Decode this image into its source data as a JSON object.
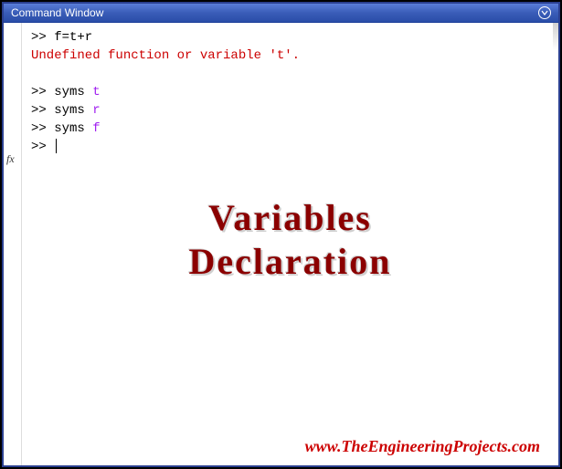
{
  "titlebar": {
    "title": "Command Window"
  },
  "gutter": {
    "fx_label": "fx"
  },
  "console": {
    "line1": ">> f=t+r",
    "error": "Undefined function or variable 't'.",
    "line2_prefix": ">> ",
    "line2_cmd": "syms ",
    "line2_var": "t",
    "line3_prefix": ">> ",
    "line3_cmd": "syms ",
    "line3_var": "r",
    "line4_prefix": ">> ",
    "line4_cmd": "syms ",
    "line4_var": "f",
    "line5": ">> "
  },
  "overlay": {
    "title_line1": "Variables",
    "title_line2": "Declaration"
  },
  "watermark": {
    "text": "www.TheEngineeringProjects.com"
  }
}
